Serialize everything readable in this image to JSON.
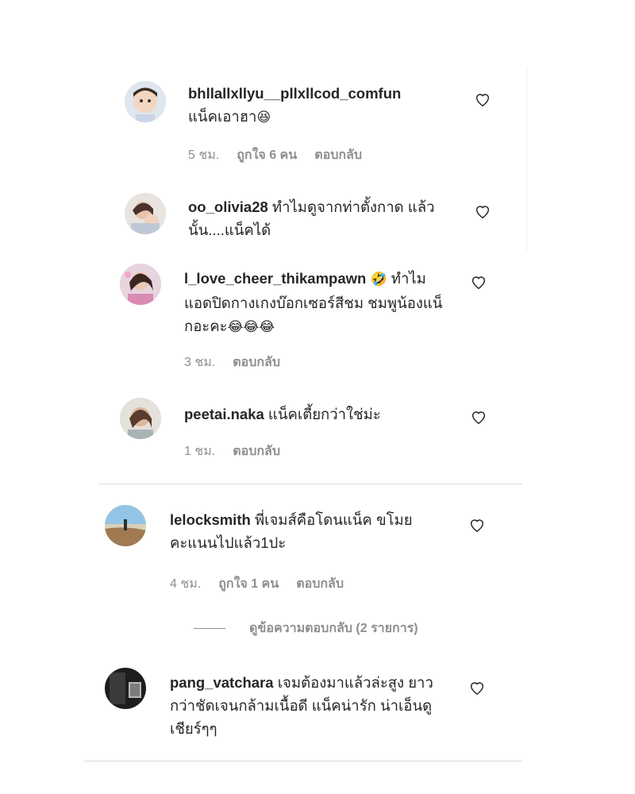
{
  "comments": [
    {
      "username": "bhllallxllyu__pllxllcod_comfun",
      "text": "แน็คเอาฮา",
      "emoji": "😆",
      "time": "5 ชม.",
      "likes": "ถูกใจ 6 คน",
      "reply": "ตอบกลับ"
    },
    {
      "username": "oo_olivia28",
      "text": "ทำไมดูจากท่าตั้งกาด แล้วนั้น....แน็คได้"
    },
    {
      "username": "l_love_cheer_thikampawn",
      "emoji": "🤣",
      "text": "ทำไมแอดปิดกางเกงบ๊อกเซอร์สีชม ชมพูน้องแน็กอะคะ",
      "emoji2": "😂😂😂",
      "time": "3 ชม.",
      "reply": "ตอบกลับ"
    },
    {
      "username": "peetai.naka",
      "text": "แน็คเตี้ยกว่าใช่ม่ะ",
      "time": "1 ชม.",
      "reply": "ตอบกลับ"
    },
    {
      "username": "lelocksmith",
      "text": "พี่เจมส์คือโดนแน็ค ขโมยคะแนนไปแล้ว1ปะ",
      "time": "4 ชม.",
      "likes": "ถูกใจ 1 คน",
      "reply": "ตอบกลับ"
    },
    {
      "username": "pang_vatchara",
      "text": "เจมต้องมาแล้วล่ะสูง ยาวกว่าชัดเจนกล้ามเนื้อดี แน็คน่ารัก น่าเอ็นดูเชียร์ๆๆ"
    }
  ],
  "view_replies": "ดูข้อความตอบกลับ (2 รายการ)"
}
